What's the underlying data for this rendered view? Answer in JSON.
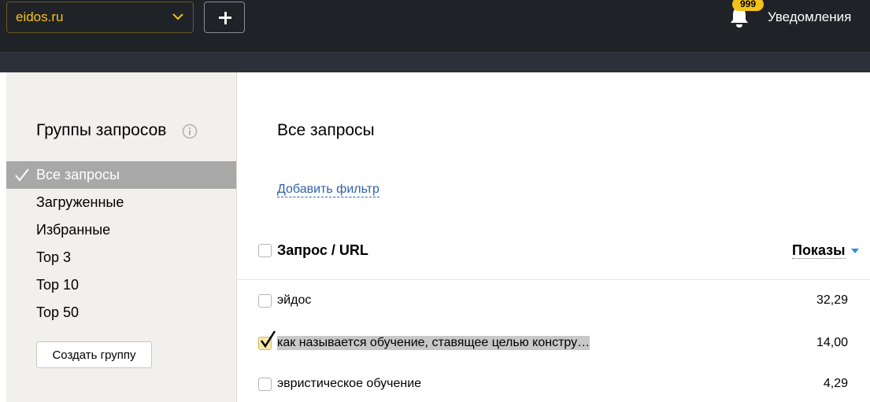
{
  "header": {
    "site_select": {
      "value": "eidos.ru"
    },
    "notifications": {
      "badge": "999",
      "label": "Уведомления"
    }
  },
  "sidebar": {
    "title": "Группы запросов",
    "items": [
      {
        "label": "Все запросы",
        "active": true
      },
      {
        "label": "Загруженные"
      },
      {
        "label": "Избранные"
      },
      {
        "label": "Top 3"
      },
      {
        "label": "Top 10"
      },
      {
        "label": "Top 50"
      }
    ],
    "create_button": "Создать группу"
  },
  "main": {
    "title": "Все запросы",
    "add_filter": "Добавить фильтр",
    "table": {
      "col_query": "Запрос / URL",
      "col_shows": "Показы",
      "rows": [
        {
          "query": "эйдос",
          "shows": "32,29",
          "checked": false
        },
        {
          "query": "как называется обучение, ставящее целью констру…",
          "shows": "14,00",
          "checked": true
        },
        {
          "query": "эвристическое обучение",
          "shows": "4,29",
          "checked": false
        }
      ]
    }
  },
  "colors": {
    "topbar": "#1f2227",
    "accent": "#f5c21b",
    "link": "#2e63a8",
    "sidebar_bg": "#f2f0ed",
    "active_item": "#a8a8a8"
  }
}
